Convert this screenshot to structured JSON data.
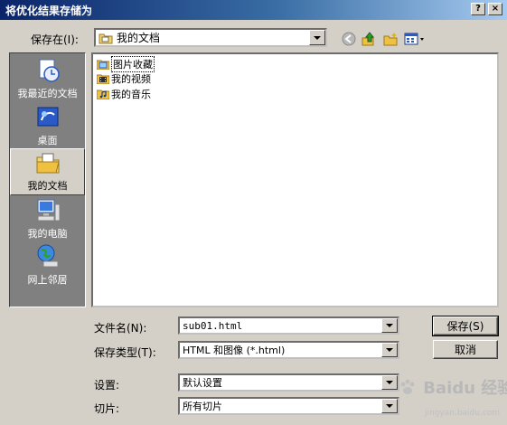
{
  "window": {
    "title": "将优化结果存储为",
    "help_button": "?",
    "close_button": "×"
  },
  "save_in": {
    "label": "保存在(I):",
    "value": "我的文档"
  },
  "toolbar": {
    "icons": [
      "back-icon",
      "up-folder-icon",
      "new-folder-icon",
      "view-menu-icon"
    ]
  },
  "places": [
    {
      "label": "我最近的文档",
      "icon": "recent-documents-icon"
    },
    {
      "label": "桌面",
      "icon": "desktop-icon"
    },
    {
      "label": "我的文档",
      "icon": "my-documents-icon",
      "selected": true
    },
    {
      "label": "我的电脑",
      "icon": "my-computer-icon"
    },
    {
      "label": "网上邻居",
      "icon": "network-places-icon"
    }
  ],
  "files": [
    {
      "name": "图片收藏",
      "icon": "folder-pictures-icon"
    },
    {
      "name": "我的视频",
      "icon": "folder-videos-icon"
    },
    {
      "name": "我的音乐",
      "icon": "folder-music-icon"
    }
  ],
  "form": {
    "filename_label": "文件名(N):",
    "filename_value": "sub01.html",
    "type_label": "保存类型(T):",
    "type_value": "HTML 和图像 (*.html)",
    "settings_label": "设置:",
    "settings_value": "默认设置",
    "slices_label": "切片:",
    "slices_value": "所有切片"
  },
  "buttons": {
    "save": "保存(S)",
    "cancel": "取消"
  },
  "watermark": {
    "text": "Baidu 经验",
    "url": "jingyan.baidu.com"
  },
  "colors": {
    "title_start": "#0a246a",
    "title_end": "#a6caf0",
    "face": "#d4d0c8",
    "places_bg": "#808080"
  }
}
